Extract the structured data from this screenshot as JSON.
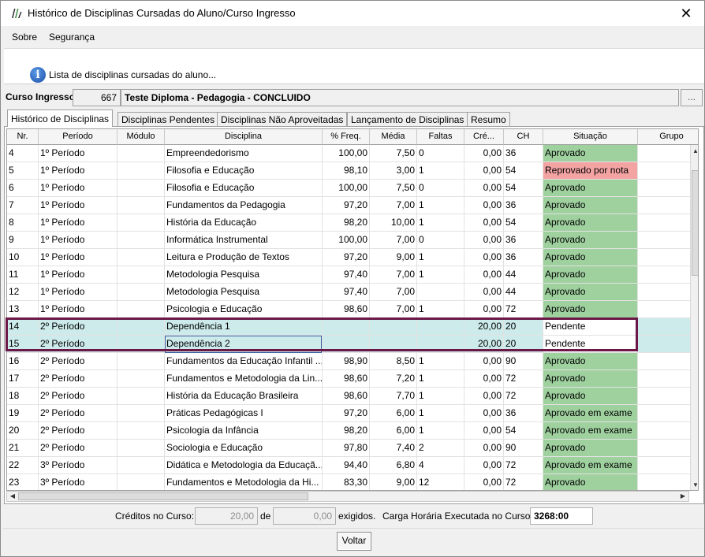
{
  "window": {
    "title": "Histórico de Disciplinas Cursadas do Aluno/Curso Ingresso",
    "close_label": "✕"
  },
  "menu": {
    "items": [
      "Sobre",
      "Segurança"
    ]
  },
  "info": {
    "icon": "info-icon",
    "text": "Lista de disciplinas cursadas do aluno..."
  },
  "curso": {
    "label": "Curso Ingresso:",
    "code": "667",
    "name": "Teste Diploma - Pedagogia - CONCLUIDO",
    "browse_label": "..."
  },
  "tabs": [
    "Histórico de Disciplinas",
    "Disciplinas Pendentes",
    "Disciplinas Não Aproveitadas",
    "Lançamento de Disciplinas",
    "Resumo"
  ],
  "table": {
    "columns": [
      "Nr.",
      "Período",
      "Módulo",
      "Disciplina",
      "% Freq.",
      "Média",
      "Faltas",
      "Cré...",
      "CH",
      "Situação",
      "Grupo"
    ],
    "rows": [
      {
        "nr": "4",
        "periodo": "1º Período",
        "modulo": "",
        "disciplina": "Empreendedorismo",
        "freq": "100,00",
        "media": "7,50",
        "faltas": "0",
        "cred": "0,00",
        "ch": "36",
        "situacao": "Aprovado",
        "status": "approved",
        "grupo": ""
      },
      {
        "nr": "5",
        "periodo": "1º Período",
        "modulo": "",
        "disciplina": "Filosofia e Educação",
        "freq": "98,10",
        "media": "3,00",
        "faltas": "1",
        "cred": "0,00",
        "ch": "54",
        "situacao": "Reprovado por nota",
        "status": "failed",
        "grupo": ""
      },
      {
        "nr": "6",
        "periodo": "1º Período",
        "modulo": "",
        "disciplina": "Filosofia e Educação",
        "freq": "100,00",
        "media": "7,50",
        "faltas": "0",
        "cred": "0,00",
        "ch": "54",
        "situacao": "Aprovado",
        "status": "approved",
        "grupo": ""
      },
      {
        "nr": "7",
        "periodo": "1º Período",
        "modulo": "",
        "disciplina": "Fundamentos da Pedagogia",
        "freq": "97,20",
        "media": "7,00",
        "faltas": "1",
        "cred": "0,00",
        "ch": "36",
        "situacao": "Aprovado",
        "status": "approved",
        "grupo": ""
      },
      {
        "nr": "8",
        "periodo": "1º Período",
        "modulo": "",
        "disciplina": "História da Educação",
        "freq": "98,20",
        "media": "10,00",
        "faltas": "1",
        "cred": "0,00",
        "ch": "54",
        "situacao": "Aprovado",
        "status": "approved",
        "grupo": ""
      },
      {
        "nr": "9",
        "periodo": "1º Período",
        "modulo": "",
        "disciplina": "Informática Instrumental",
        "freq": "100,00",
        "media": "7,00",
        "faltas": "0",
        "cred": "0,00",
        "ch": "36",
        "situacao": "Aprovado",
        "status": "approved",
        "grupo": ""
      },
      {
        "nr": "10",
        "periodo": "1º Período",
        "modulo": "",
        "disciplina": "Leitura e Produção de Textos",
        "freq": "97,20",
        "media": "9,00",
        "faltas": "1",
        "cred": "0,00",
        "ch": "36",
        "situacao": "Aprovado",
        "status": "approved",
        "grupo": ""
      },
      {
        "nr": "11",
        "periodo": "1º Período",
        "modulo": "",
        "disciplina": "Metodologia Pesquisa",
        "freq": "97,40",
        "media": "7,00",
        "faltas": "1",
        "cred": "0,00",
        "ch": "44",
        "situacao": "Aprovado",
        "status": "approved",
        "grupo": ""
      },
      {
        "nr": "12",
        "periodo": "1º Período",
        "modulo": "",
        "disciplina": "Metodologia Pesquisa",
        "freq": "97,40",
        "media": "7,00",
        "faltas": "",
        "cred": "0,00",
        "ch": "44",
        "situacao": "Aprovado",
        "status": "approved",
        "grupo": ""
      },
      {
        "nr": "13",
        "periodo": "1º Período",
        "modulo": "",
        "disciplina": "Psicologia e Educação",
        "freq": "98,60",
        "media": "7,00",
        "faltas": "1",
        "cred": "0,00",
        "ch": "72",
        "situacao": "Aprovado",
        "status": "approved",
        "grupo": ""
      },
      {
        "nr": "14",
        "periodo": "2º Período",
        "modulo": "",
        "disciplina": "Dependência 1",
        "freq": "",
        "media": "",
        "faltas": "",
        "cred": "20,00",
        "ch": "20",
        "situacao": "Pendente",
        "status": "pending",
        "grupo": ""
      },
      {
        "nr": "15",
        "periodo": "2º Período",
        "modulo": "",
        "disciplina": "Dependência 2",
        "freq": "",
        "media": "",
        "faltas": "",
        "cred": "20,00",
        "ch": "20",
        "situacao": "Pendente",
        "status": "pending",
        "grupo": ""
      },
      {
        "nr": "16",
        "periodo": "2º Período",
        "modulo": "",
        "disciplina": "Fundamentos da Educação Infantil ...",
        "freq": "98,90",
        "media": "8,50",
        "faltas": "1",
        "cred": "0,00",
        "ch": "90",
        "situacao": "Aprovado",
        "status": "approved",
        "grupo": ""
      },
      {
        "nr": "17",
        "periodo": "2º Período",
        "modulo": "",
        "disciplina": "Fundamentos e Metodologia da Lin...",
        "freq": "98,60",
        "media": "7,20",
        "faltas": "1",
        "cred": "0,00",
        "ch": "72",
        "situacao": "Aprovado",
        "status": "approved",
        "grupo": ""
      },
      {
        "nr": "18",
        "periodo": "2º Período",
        "modulo": "",
        "disciplina": "História da Educação Brasileira",
        "freq": "98,60",
        "media": "7,70",
        "faltas": "1",
        "cred": "0,00",
        "ch": "72",
        "situacao": "Aprovado",
        "status": "approved",
        "grupo": ""
      },
      {
        "nr": "19",
        "periodo": "2º Período",
        "modulo": "",
        "disciplina": "Práticas Pedagógicas I",
        "freq": "97,20",
        "media": "6,00",
        "faltas": "1",
        "cred": "0,00",
        "ch": "36",
        "situacao": "Aprovado em exame",
        "status": "approved",
        "grupo": ""
      },
      {
        "nr": "20",
        "periodo": "2º Período",
        "modulo": "",
        "disciplina": "Psicologia da Infância",
        "freq": "98,20",
        "media": "6,00",
        "faltas": "1",
        "cred": "0,00",
        "ch": "54",
        "situacao": "Aprovado em exame",
        "status": "approved",
        "grupo": ""
      },
      {
        "nr": "21",
        "periodo": "2º Período",
        "modulo": "",
        "disciplina": "Sociologia e Educação",
        "freq": "97,80",
        "media": "7,40",
        "faltas": "2",
        "cred": "0,00",
        "ch": "90",
        "situacao": "Aprovado",
        "status": "approved",
        "grupo": ""
      },
      {
        "nr": "22",
        "periodo": "3º Período",
        "modulo": "",
        "disciplina": "Didática e Metodologia da Educaçã...",
        "freq": "94,40",
        "media": "6,80",
        "faltas": "4",
        "cred": "0,00",
        "ch": "72",
        "situacao": "Aprovado em exame",
        "status": "approved",
        "grupo": ""
      },
      {
        "nr": "23",
        "periodo": "3º Período",
        "modulo": "",
        "disciplina": "Fundamentos e Metodologia da Hi...",
        "freq": "83,30",
        "media": "9,00",
        "faltas": "12",
        "cred": "0,00",
        "ch": "72",
        "situacao": "Aprovado",
        "status": "approved",
        "grupo": ""
      }
    ]
  },
  "footer": {
    "creditos_label": "Créditos no Curso:",
    "creditos_value": "20,00",
    "de_label": "de",
    "exigidos_value": "0,00",
    "exigidos_label": "exigidos.",
    "carga_label": "Carga Horária Executada no Curso:",
    "carga_value": "3268:00"
  },
  "buttons": {
    "voltar": "Voltar"
  },
  "colors": {
    "approved": "#9fd19f",
    "failed": "#f4a3a3",
    "selected_row": "#cdebeb",
    "highlight_border": "#6b1848"
  }
}
